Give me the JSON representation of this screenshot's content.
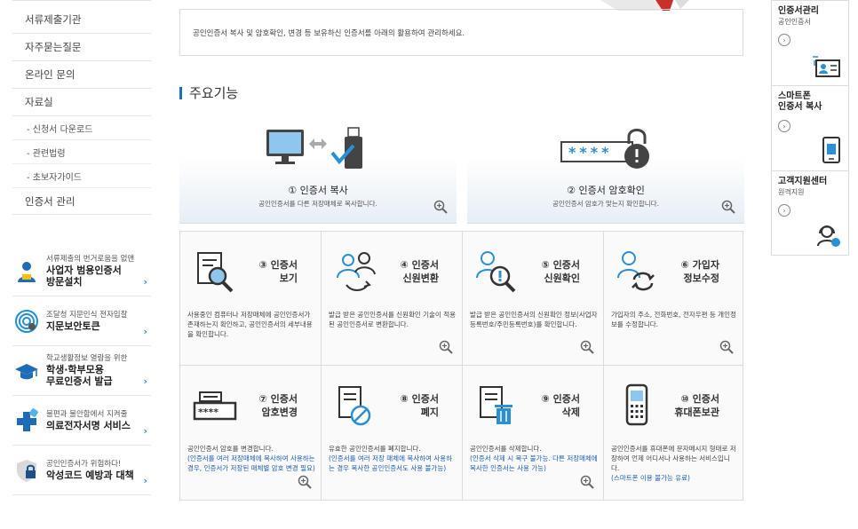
{
  "left_nav": {
    "items": [
      "서류제출기관",
      "자주묻는질문",
      "온라인 문의",
      "자료실"
    ],
    "sub_items": [
      "- 신청서 다운로드",
      "- 관련법령",
      "- 초보자가이드"
    ],
    "last_item": "인증서 관리"
  },
  "promos": [
    {
      "small": "서류제출의 번거로움을 없앤",
      "big1": "사업자 범용인증서",
      "big2": "방문설치",
      "icon": "person-badge-icon"
    },
    {
      "small": "조달청 지문인식 전자입찰",
      "big1": "지문보안토큰",
      "big2": "",
      "icon": "fingerprint-icon"
    },
    {
      "small": "학교생활정보 열람을 위한",
      "big1": "학생·학부모용",
      "big2": "무료인증서  발급",
      "icon": "graduation-cap-icon"
    },
    {
      "small": "불편과 불안함에서 지켜줄",
      "big1": "의료전자서명 서비스",
      "big2": "",
      "icon": "medical-cross-icon"
    },
    {
      "small": "공인인증서가 위험하다!",
      "big1": "악성코드 예방과 대책",
      "big2": "",
      "icon": "shield-lock-icon"
    }
  ],
  "promo_arrow": "›",
  "intro_text": "공인인증서 복사 및 암호확인, 변경 등 보유하신 인증서를 아래의 활용하여 관리하세요.",
  "section_title": "주요기능",
  "top_cards": [
    {
      "title": "① 인증서 복사",
      "desc": "공인인증서를 다른 저장매체로 복사합니다."
    },
    {
      "title": "② 인증서 암호확인",
      "desc": "공인인증서 암호가 맞는지 확인합니다.",
      "stars": "****"
    }
  ],
  "cells": [
    {
      "title": "③ 인증서\n보기",
      "desc": "사용중인 컴퓨터나 저장매체에 공인인증서가 존재하는지 확인하고, 공인인증서의 세부내용을 확인합니다.",
      "desc_blue": ""
    },
    {
      "title": "④ 인증서\n신원변환",
      "desc": "발급 받은 공인인증서를 신원확인 기술이 적용된 공인인증서로 변환합니다.",
      "desc_blue": ""
    },
    {
      "title": "⑤ 인증서\n신원확인",
      "desc": "발급 받은 공인인증서의 신원확인 정보(사업자등록번호/주민등록번호)를 확인합니다.",
      "desc_blue": ""
    },
    {
      "title": "⑥ 가입자\n정보수정",
      "desc": "가입자의 주소, 전화번호, 전자우편 등 개인정보를 수정합니다.",
      "desc_blue": ""
    },
    {
      "title": "⑦ 인증서\n암호변경",
      "desc": "공인인증서 암호를 변경합니다.",
      "desc_blue": "(인증서를 여러 저장매체에 복사하여 사용하는 경우, 인증서가 저장된 매체별 암호 변경 필요)",
      "stars": "****"
    },
    {
      "title": "⑧ 인증서\n폐지",
      "desc": "유효한 공인인증서를 폐지합니다.",
      "desc_blue": "(인증서를 여러 저장 매체에 복사하여 사용하는 경우 복사한 공인인증서도 사용 불가능)"
    },
    {
      "title": "⑨ 인증서\n삭제",
      "desc": "공인인증서를 삭제합니다.",
      "desc_blue": "(인증서 삭제 시 복구 불가능. 다른 저장매체에 복사한 인증서는 사용 가능)"
    },
    {
      "title": "⑩ 인증서\n휴대폰보관",
      "desc": "공인인증서를 휴대폰에 문자메시지 형태로 저장하여 언제 어디서나 사용하는 서비스입니다.",
      "desc_blue": "(스마트폰 이용 불가능 유료)"
    }
  ],
  "right_panel": [
    {
      "title": "인증서관리",
      "sub": "공인인증서"
    },
    {
      "title": "스마트폰\n인증서 복사",
      "sub": ""
    },
    {
      "title": "고객지원센터",
      "sub": "원격지원"
    }
  ],
  "circle_arrow": "›",
  "colors": {
    "accent": "#1b6fc1",
    "blue_text": "#1a5fb8",
    "icon_blue": "#1e6bb8",
    "icon_dark": "#333333"
  }
}
